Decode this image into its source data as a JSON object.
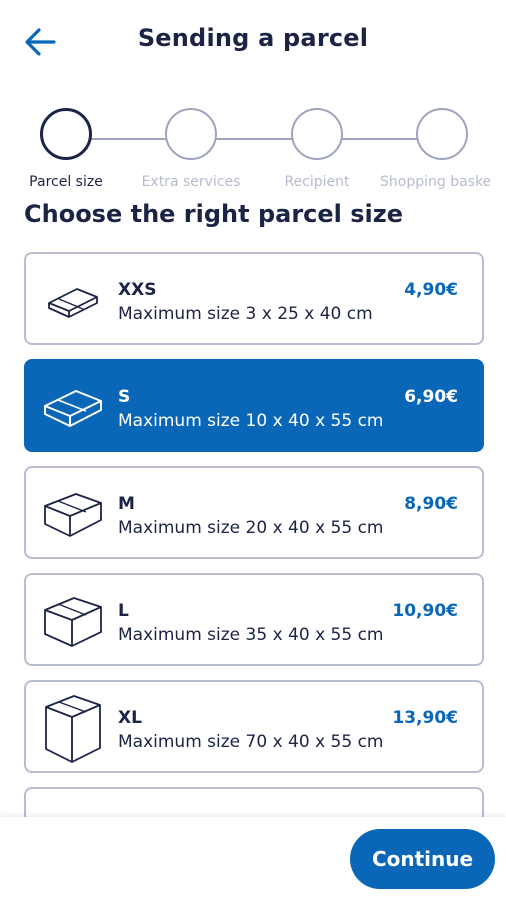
{
  "header": {
    "title": "Sending a parcel",
    "back_icon": "arrow-left-icon"
  },
  "stepper": {
    "steps": [
      {
        "label": "Parcel size",
        "active": true
      },
      {
        "label": "Extra services",
        "active": false
      },
      {
        "label": "Recipient",
        "active": false
      },
      {
        "label": "Shopping basket",
        "active": false
      }
    ]
  },
  "section_title": "Choose the right parcel size",
  "parcels": [
    {
      "size": "XXS",
      "dims": "Maximum size 3 x 25 x 40 cm",
      "price": "4,90€",
      "selected": false,
      "icon": "flat-package-icon"
    },
    {
      "size": "S",
      "dims": "Maximum size 10 x 40 x 55 cm",
      "price": "6,90€",
      "selected": true,
      "icon": "small-box-icon"
    },
    {
      "size": "M",
      "dims": "Maximum size 20 x 40 x 55 cm",
      "price": "8,90€",
      "selected": false,
      "icon": "medium-box-icon"
    },
    {
      "size": "L",
      "dims": "Maximum size 35 x 40 x 55 cm",
      "price": "10,90€",
      "selected": false,
      "icon": "large-box-icon"
    },
    {
      "size": "XL",
      "dims": "Maximum size 70 x 40 x 55 cm",
      "price": "13,90€",
      "selected": false,
      "icon": "xl-box-icon"
    }
  ],
  "footer": {
    "continue_label": "Continue"
  },
  "colors": {
    "primary": "#0a67b8",
    "text": "#1b2444",
    "border": "#b9bdd0",
    "muted": "#b7bccd"
  }
}
